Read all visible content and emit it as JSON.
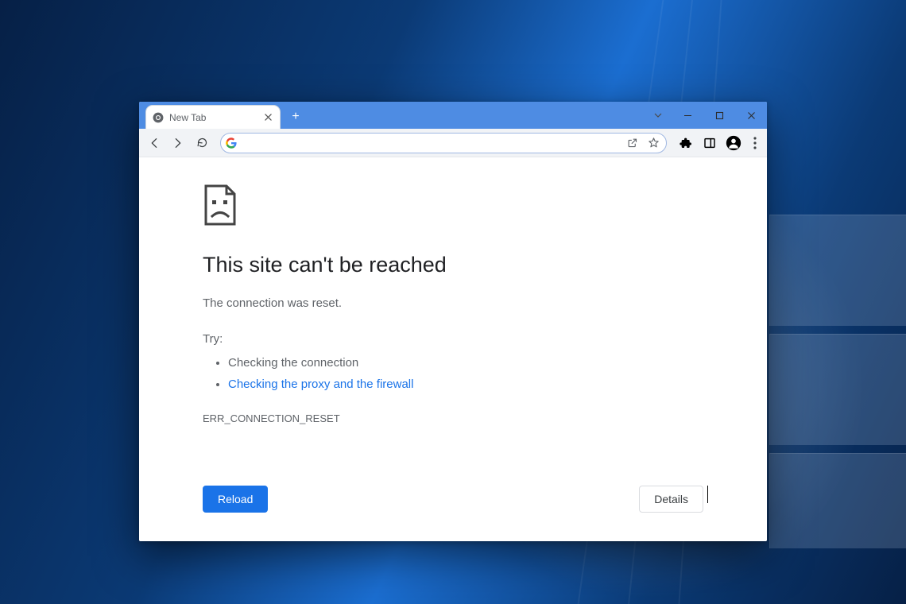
{
  "tab": {
    "title": "New Tab"
  },
  "omnibox": {
    "value": "",
    "placeholder": ""
  },
  "error": {
    "heading": "This site can't be reached",
    "message": "The connection was reset.",
    "try_label": "Try:",
    "suggestions": {
      "check_connection": "Checking the connection",
      "check_proxy_firewall": "Checking the proxy and the firewall"
    },
    "error_code": "ERR_CONNECTION_RESET",
    "reload_label": "Reload",
    "details_label": "Details"
  },
  "colors": {
    "tabstrip": "#4e8ce3",
    "primary": "#1a73e8",
    "link": "#1a73e8",
    "text": "#202124",
    "muted": "#5f6368"
  }
}
